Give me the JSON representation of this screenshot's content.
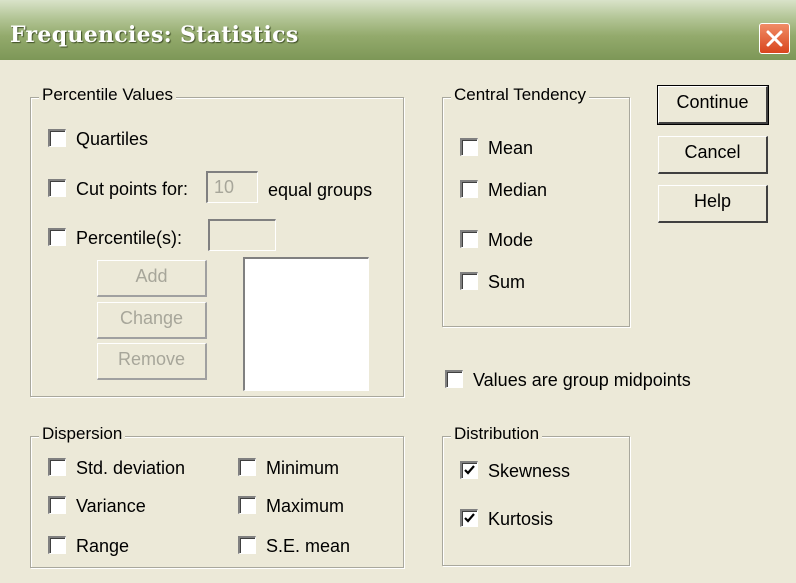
{
  "title": "Frequencies: Statistics",
  "close_icon": "close-icon",
  "percentile_values": {
    "legend": "Percentile Values",
    "quartiles": {
      "label": "Quartiles",
      "checked": false
    },
    "cut_points": {
      "label": "Cut points for:",
      "value": "10",
      "suffix": "equal groups",
      "checked": false
    },
    "percentiles": {
      "label": "Percentile(s):",
      "value": "",
      "checked": false
    },
    "add_label": "Add",
    "change_label": "Change",
    "remove_label": "Remove"
  },
  "central_tendency": {
    "legend": "Central Tendency",
    "mean": {
      "label": "Mean",
      "checked": false
    },
    "median": {
      "label": "Median",
      "checked": false
    },
    "mode": {
      "label": "Mode",
      "checked": false
    },
    "sum": {
      "label": "Sum",
      "checked": false
    }
  },
  "buttons": {
    "continue": "Continue",
    "cancel": "Cancel",
    "help": "Help"
  },
  "midpoints": {
    "label": "Values are group midpoints",
    "checked": false
  },
  "dispersion": {
    "legend": "Dispersion",
    "std_deviation": {
      "label": "Std. deviation",
      "checked": false
    },
    "variance": {
      "label": "Variance",
      "checked": false
    },
    "range": {
      "label": "Range",
      "checked": false
    },
    "minimum": {
      "label": "Minimum",
      "checked": false
    },
    "maximum": {
      "label": "Maximum",
      "checked": false
    },
    "se_mean": {
      "label": "S.E. mean",
      "checked": false
    }
  },
  "distribution": {
    "legend": "Distribution",
    "skewness": {
      "label": "Skewness",
      "checked": true
    },
    "kurtosis": {
      "label": "Kurtosis",
      "checked": true
    }
  },
  "colors": {
    "title_bar": "#93aa6c",
    "dialog_bg": "#ece9d8",
    "close_button": "#d9451d",
    "disabled_text": "#a7a69a"
  }
}
